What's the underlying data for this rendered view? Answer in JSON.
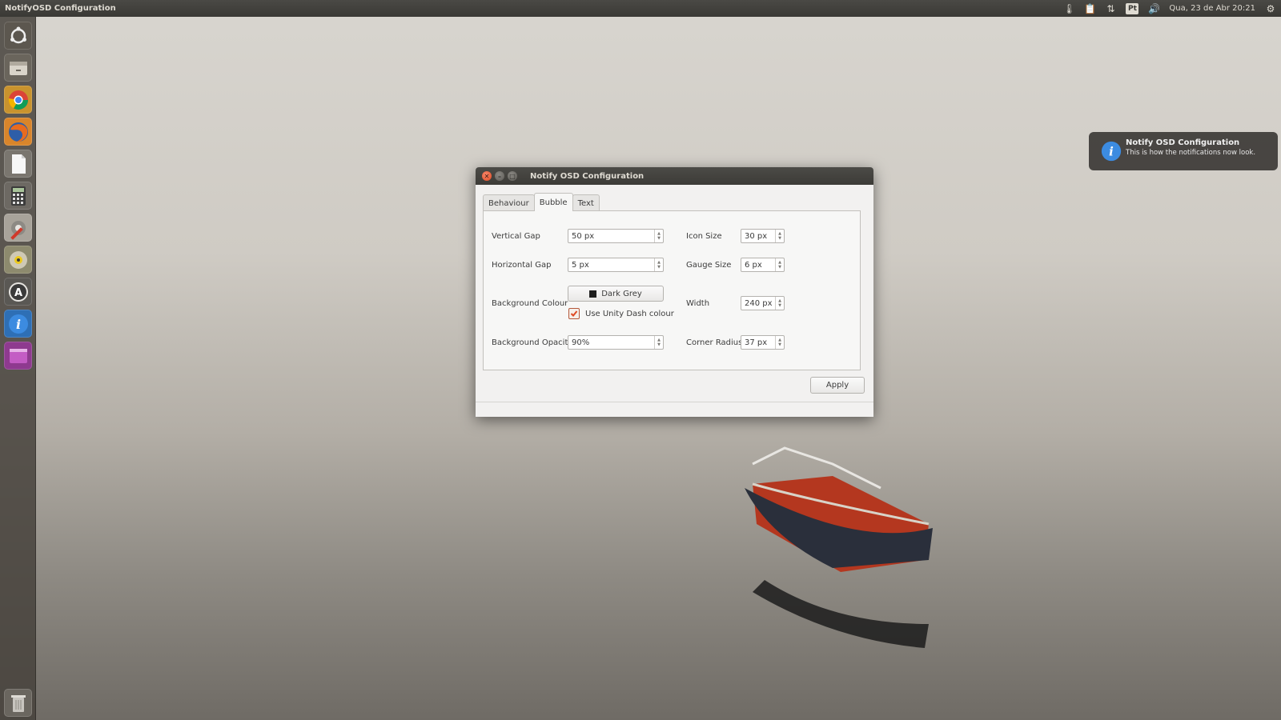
{
  "topbar": {
    "app_title": "NotifyOSD Configuration",
    "keyboard_layout": "Pt",
    "clock": "Qua, 23 de Abr 20:21"
  },
  "launcher": {
    "items": [
      {
        "name": "dash-home",
        "icon": "ubuntu-logo-icon"
      },
      {
        "name": "files",
        "icon": "file-manager-icon"
      },
      {
        "name": "chrome",
        "icon": "chrome-icon"
      },
      {
        "name": "firefox",
        "icon": "firefox-icon"
      },
      {
        "name": "text-editor",
        "icon": "document-icon"
      },
      {
        "name": "calculator",
        "icon": "calculator-icon"
      },
      {
        "name": "system-tools",
        "icon": "tools-icon"
      },
      {
        "name": "disk-burner",
        "icon": "disc-icon"
      },
      {
        "name": "software-updater",
        "icon": "updater-icon"
      },
      {
        "name": "notifyosd-config",
        "icon": "info-icon"
      },
      {
        "name": "workspace-switcher",
        "icon": "workspace-icon"
      },
      {
        "name": "trash",
        "icon": "trash-icon"
      }
    ]
  },
  "notification": {
    "title": "Notify OSD Configuration",
    "body": "This is how the notifications now look."
  },
  "dialog": {
    "title": "Notify OSD Configuration",
    "tabs": [
      "Behaviour",
      "Bubble",
      "Text"
    ],
    "active_tab": "Bubble",
    "fields": {
      "vertical_gap": {
        "label": "Vertical Gap",
        "value": "50 px"
      },
      "horizontal_gap": {
        "label": "Horizontal Gap",
        "value": "5 px"
      },
      "background_colour": {
        "label": "Background Colour",
        "value": "Dark Grey",
        "swatch": "#1e1e1e"
      },
      "use_unity_dash": {
        "label": "Use Unity Dash colour",
        "checked": true
      },
      "background_opacity": {
        "label": "Background Opacity",
        "value": "90%"
      },
      "icon_size": {
        "label": "Icon Size",
        "value": "30 px"
      },
      "gauge_size": {
        "label": "Gauge Size",
        "value": "6 px"
      },
      "width": {
        "label": "Width",
        "value": "240 px"
      },
      "corner_radius": {
        "label": "Corner Radius",
        "value": "37 px"
      }
    },
    "apply_label": "Apply"
  },
  "colors": {
    "accent": "#df4a22",
    "panel_bg": "#3c3b37",
    "dialog_bg": "#f2f1f0"
  }
}
